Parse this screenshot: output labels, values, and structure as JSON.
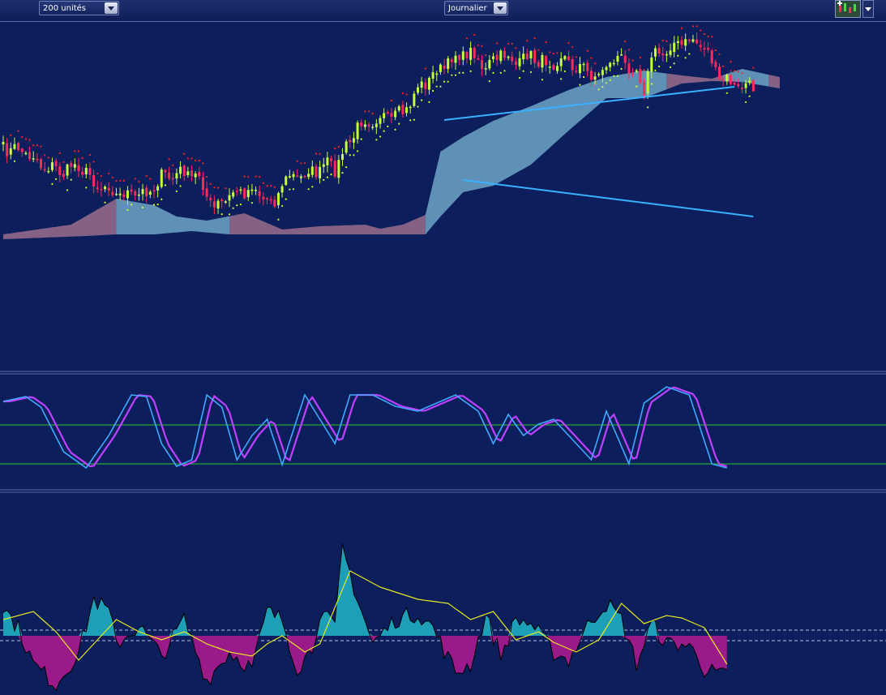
{
  "toolbar": {
    "units_select": {
      "value": "200 unités"
    },
    "period_select": {
      "value": "Journalier"
    },
    "chart_tool_icon": "candlestick-add-icon",
    "chart_tool_menu_icon": "chevron-down-icon"
  },
  "colors": {
    "background": "#0c1f5c",
    "bull_candle": "#c8ff3c",
    "bear_candle": "#ff2a5a",
    "cloud_bull": "#6fa6c6",
    "cloud_bear": "#9a6d8c",
    "sar_bull": "#d6ff2a",
    "sar_bear": "#ff2020",
    "trendline": "#3ab0ff",
    "stoch_k": "#40a8ff",
    "stoch_d": "#c040ff",
    "level_line": "#28c828",
    "osc_pos": "#1e9fb8",
    "osc_neg": "#9a1a8a",
    "signal": "#e8e820"
  },
  "chart_data": [
    {
      "type": "candlestick",
      "panel": "price",
      "overlays": [
        "ichimoku cloud",
        "parabolic SAR",
        "trendlines (broadening channel)"
      ],
      "n_bars": 200,
      "price_anchors": [
        [
          0,
          155
        ],
        [
          6,
          160
        ],
        [
          10,
          176
        ],
        [
          16,
          185
        ],
        [
          20,
          175
        ],
        [
          24,
          198
        ],
        [
          28,
          206
        ],
        [
          32,
          214
        ],
        [
          38,
          212
        ],
        [
          42,
          192
        ],
        [
          48,
          186
        ],
        [
          52,
          192
        ],
        [
          56,
          232
        ],
        [
          60,
          214
        ],
        [
          66,
          205
        ],
        [
          72,
          224
        ],
        [
          74,
          196
        ],
        [
          78,
          190
        ],
        [
          84,
          182
        ],
        [
          86,
          176
        ],
        [
          88,
          180
        ],
        [
          92,
          148
        ],
        [
          94,
          128
        ],
        [
          98,
          120
        ],
        [
          104,
          116
        ],
        [
          106,
          114
        ],
        [
          110,
          82
        ],
        [
          114,
          66
        ],
        [
          118,
          50
        ],
        [
          121,
          40
        ],
        [
          123,
          38
        ],
        [
          126,
          43
        ],
        [
          128,
          60
        ],
        [
          132,
          38
        ],
        [
          136,
          50
        ],
        [
          140,
          42
        ],
        [
          144,
          52
        ],
        [
          148,
          44
        ],
        [
          152,
          55
        ],
        [
          156,
          62
        ],
        [
          158,
          70
        ],
        [
          160,
          50
        ],
        [
          164,
          46
        ],
        [
          168,
          62
        ],
        [
          170,
          80
        ],
        [
          172,
          44
        ],
        [
          176,
          34
        ],
        [
          180,
          25
        ],
        [
          184,
          24
        ],
        [
          186,
          30
        ],
        [
          188,
          50
        ],
        [
          190,
          70
        ],
        [
          193,
          75
        ],
        [
          196,
          82
        ],
        [
          199,
          78
        ]
      ],
      "cloud_top": [
        [
          0,
          262
        ],
        [
          18,
          250
        ],
        [
          30,
          218
        ],
        [
          40,
          226
        ],
        [
          46,
          240
        ],
        [
          54,
          245
        ],
        [
          64,
          236
        ],
        [
          74,
          256
        ],
        [
          84,
          252
        ],
        [
          96,
          250
        ],
        [
          100,
          255
        ],
        [
          106,
          250
        ],
        [
          112,
          238
        ],
        [
          116,
          160
        ],
        [
          122,
          142
        ],
        [
          130,
          122
        ],
        [
          140,
          104
        ],
        [
          150,
          84
        ],
        [
          160,
          68
        ],
        [
          170,
          60
        ],
        [
          180,
          66
        ],
        [
          188,
          70
        ],
        [
          196,
          58
        ],
        [
          206,
          68
        ]
      ],
      "cloud_bottom": [
        [
          0,
          268
        ],
        [
          22,
          264
        ],
        [
          30,
          262
        ],
        [
          40,
          262
        ],
        [
          50,
          258
        ],
        [
          60,
          262
        ],
        [
          70,
          262
        ],
        [
          84,
          262
        ],
        [
          96,
          262
        ],
        [
          104,
          262
        ],
        [
          112,
          262
        ],
        [
          116,
          240
        ],
        [
          122,
          210
        ],
        [
          130,
          202
        ],
        [
          140,
          176
        ],
        [
          150,
          134
        ],
        [
          160,
          94
        ],
        [
          170,
          94
        ],
        [
          180,
          76
        ],
        [
          188,
          73
        ],
        [
          196,
          74
        ],
        [
          206,
          82
        ]
      ],
      "trendlines": [
        {
          "from": [
            117,
            121
          ],
          "to": [
            194,
            80
          ]
        },
        {
          "from": [
            122,
            195
          ],
          "to": [
            199,
            240
          ]
        }
      ]
    },
    {
      "type": "line",
      "panel": "stochastic",
      "series": [
        {
          "role": "%K",
          "color": "#40a8ff"
        },
        {
          "role": "%D",
          "color": "#c040ff"
        }
      ],
      "levels": [
        80,
        20
      ],
      "anchors": [
        [
          0,
          82
        ],
        [
          6,
          88
        ],
        [
          10,
          75
        ],
        [
          16,
          20
        ],
        [
          22,
          0
        ],
        [
          28,
          40
        ],
        [
          34,
          90
        ],
        [
          38,
          88
        ],
        [
          42,
          30
        ],
        [
          46,
          2
        ],
        [
          50,
          10
        ],
        [
          54,
          90
        ],
        [
          58,
          75
        ],
        [
          62,
          10
        ],
        [
          66,
          40
        ],
        [
          70,
          60
        ],
        [
          74,
          4
        ],
        [
          80,
          90
        ],
        [
          84,
          60
        ],
        [
          88,
          30
        ],
        [
          92,
          90
        ],
        [
          98,
          90
        ],
        [
          104,
          76
        ],
        [
          110,
          70
        ],
        [
          120,
          90
        ],
        [
          126,
          70
        ],
        [
          130,
          30
        ],
        [
          134,
          66
        ],
        [
          138,
          40
        ],
        [
          142,
          54
        ],
        [
          146,
          60
        ],
        [
          150,
          40
        ],
        [
          156,
          10
        ],
        [
          160,
          70
        ],
        [
          166,
          5
        ],
        [
          170,
          80
        ],
        [
          176,
          100
        ],
        [
          182,
          90
        ],
        [
          188,
          5
        ],
        [
          192,
          0
        ]
      ]
    },
    {
      "type": "area",
      "panel": "oscillator",
      "series": [
        {
          "role": "histogram",
          "positive_color": "#1e9fb8",
          "negative_color": "#9a1a8a"
        },
        {
          "role": "signal",
          "color": "#e8e820"
        }
      ],
      "dashed_levels": [
        "upper",
        "lower"
      ],
      "histogram_anchors": [
        [
          0,
          35
        ],
        [
          4,
          10
        ],
        [
          8,
          -35
        ],
        [
          14,
          -60
        ],
        [
          20,
          -20
        ],
        [
          24,
          45
        ],
        [
          28,
          30
        ],
        [
          30,
          -10
        ],
        [
          36,
          12
        ],
        [
          42,
          -25
        ],
        [
          48,
          20
        ],
        [
          54,
          -55
        ],
        [
          60,
          -20
        ],
        [
          66,
          -40
        ],
        [
          70,
          30
        ],
        [
          74,
          20
        ],
        [
          78,
          -40
        ],
        [
          82,
          -15
        ],
        [
          84,
          30
        ],
        [
          88,
          10
        ],
        [
          90,
          108
        ],
        [
          94,
          45
        ],
        [
          98,
          -10
        ],
        [
          104,
          20
        ],
        [
          110,
          28
        ],
        [
          114,
          10
        ],
        [
          120,
          -45
        ],
        [
          124,
          -35
        ],
        [
          128,
          25
        ],
        [
          132,
          -25
        ],
        [
          136,
          20
        ],
        [
          140,
          15
        ],
        [
          146,
          -20
        ],
        [
          150,
          -30
        ],
        [
          156,
          20
        ],
        [
          160,
          40
        ],
        [
          164,
          20
        ],
        [
          168,
          -35
        ],
        [
          172,
          15
        ],
        [
          176,
          -10
        ],
        [
          180,
          -10
        ],
        [
          184,
          -20
        ],
        [
          186,
          -42
        ],
        [
          192,
          -50
        ]
      ],
      "signal_anchors": [
        [
          0,
          20
        ],
        [
          8,
          30
        ],
        [
          14,
          5
        ],
        [
          20,
          -30
        ],
        [
          24,
          -10
        ],
        [
          30,
          20
        ],
        [
          36,
          5
        ],
        [
          42,
          -5
        ],
        [
          48,
          5
        ],
        [
          54,
          -10
        ],
        [
          60,
          -20
        ],
        [
          66,
          -25
        ],
        [
          70,
          -10
        ],
        [
          74,
          0
        ],
        [
          80,
          -20
        ],
        [
          84,
          -10
        ],
        [
          92,
          80
        ],
        [
          100,
          60
        ],
        [
          110,
          45
        ],
        [
          118,
          40
        ],
        [
          124,
          20
        ],
        [
          130,
          30
        ],
        [
          136,
          -5
        ],
        [
          142,
          5
        ],
        [
          146,
          -8
        ],
        [
          152,
          -20
        ],
        [
          158,
          -5
        ],
        [
          164,
          40
        ],
        [
          170,
          15
        ],
        [
          176,
          25
        ],
        [
          180,
          22
        ],
        [
          186,
          10
        ],
        [
          192,
          -35
        ]
      ]
    }
  ]
}
